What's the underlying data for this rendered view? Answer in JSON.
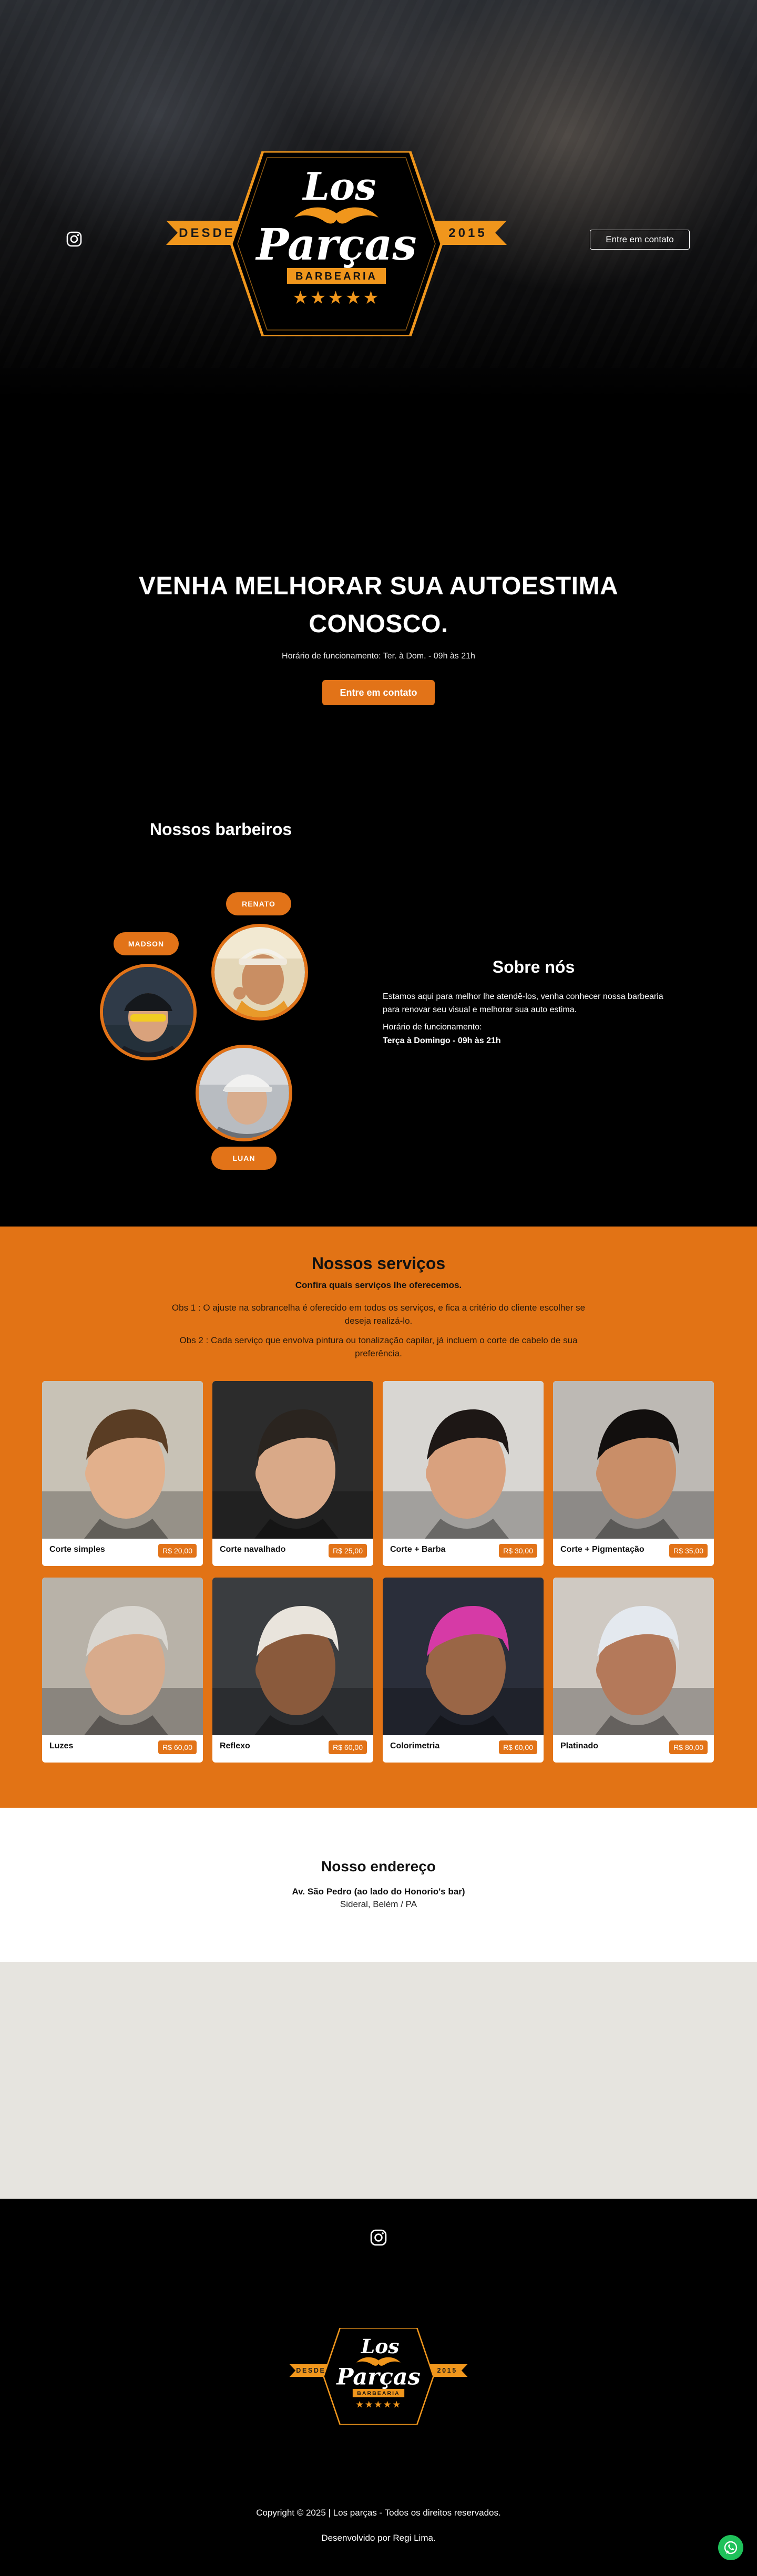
{
  "brand": {
    "name": "Los Parças",
    "sub": "BARBEARIA",
    "since_label": "DESDE",
    "since_year": "2015",
    "stars": "★★★★★"
  },
  "header": {
    "contact_button": "Entre em contato",
    "instagram_icon": "instagram-icon"
  },
  "hero": {
    "title_line1": "VENHA MELHORAR SUA AUTOESTIMA",
    "title_line2": "CONOSCO.",
    "hours": "Horário de funcionamento: Ter. à Dom. - 09h às 21h",
    "cta": "Entre em contato"
  },
  "barbers": {
    "title": "Nossos barbeiros",
    "items": [
      {
        "name": "RENATO"
      },
      {
        "name": "MADSON"
      },
      {
        "name": "LUAN"
      }
    ]
  },
  "about": {
    "title": "Sobre nós",
    "text": "Estamos aqui para melhor lhe atendê-los, venha conhecer nossa barbearia para renovar seu visual e melhorar sua auto estima.",
    "hours_label": "Horário de funcionamento:",
    "hours": "Terça à Domingo - 09h às 21h"
  },
  "services": {
    "title": "Nossos serviços",
    "subtitle": "Confira quais serviços lhe oferecemos.",
    "obs1": "Obs 1 : O ajuste na sobrancelha é oferecido em todos os serviços, e fica a critério do cliente escolher se deseja realizá-lo.",
    "obs2": "Obs 2 : Cada serviço que envolva pintura ou tonalização capilar, já incluem o corte de cabelo de sua preferência.",
    "items": [
      {
        "name": "Corte simples",
        "price": "R$ 20,00",
        "hair": "#5a3d24",
        "bg": "#c8c2b6",
        "skin": "#e2b08c"
      },
      {
        "name": "Corte navalhado",
        "price": "R$ 25,00",
        "hair": "#2a241f",
        "bg": "#2c2c2c",
        "skin": "#d9a988"
      },
      {
        "name": "Corte + Barba",
        "price": "R$ 30,00",
        "hair": "#1d1715",
        "bg": "#d8d6d2",
        "skin": "#d9a17e"
      },
      {
        "name": "Corte + Pigmentação",
        "price": "R$ 35,00",
        "hair": "#120f0e",
        "bg": "#bdb9b4",
        "skin": "#c98e68"
      },
      {
        "name": "Luzes",
        "price": "R$ 60,00",
        "hair": "#d9d6d0",
        "bg": "#b8b2a8",
        "skin": "#d8ab8c"
      },
      {
        "name": "Reflexo",
        "price": "R$ 60,00",
        "hair": "#e9e4dc",
        "bg": "#3a3d40",
        "skin": "#8a5a3c"
      },
      {
        "name": "Colorimetria",
        "price": "R$ 60,00",
        "hair": "#d63aa6",
        "bg": "#2a2e3a",
        "skin": "#9a6646"
      },
      {
        "name": "Platinado",
        "price": "R$ 80,00",
        "hair": "#e4e9ef",
        "bg": "#cfc9c2",
        "skin": "#b4795a"
      }
    ]
  },
  "address": {
    "title": "Nosso endereço",
    "line1": "Av. São Pedro (ao lado do Honorio's bar)",
    "line2": "Sideral, Belém / PA"
  },
  "footer": {
    "copyright": "Copyright © 2025 | Los parças - Todos os direitos reservados.",
    "developer": "Desenvolvido por Regi Lima."
  },
  "colors": {
    "accent": "#e27318",
    "background": "#000000"
  }
}
